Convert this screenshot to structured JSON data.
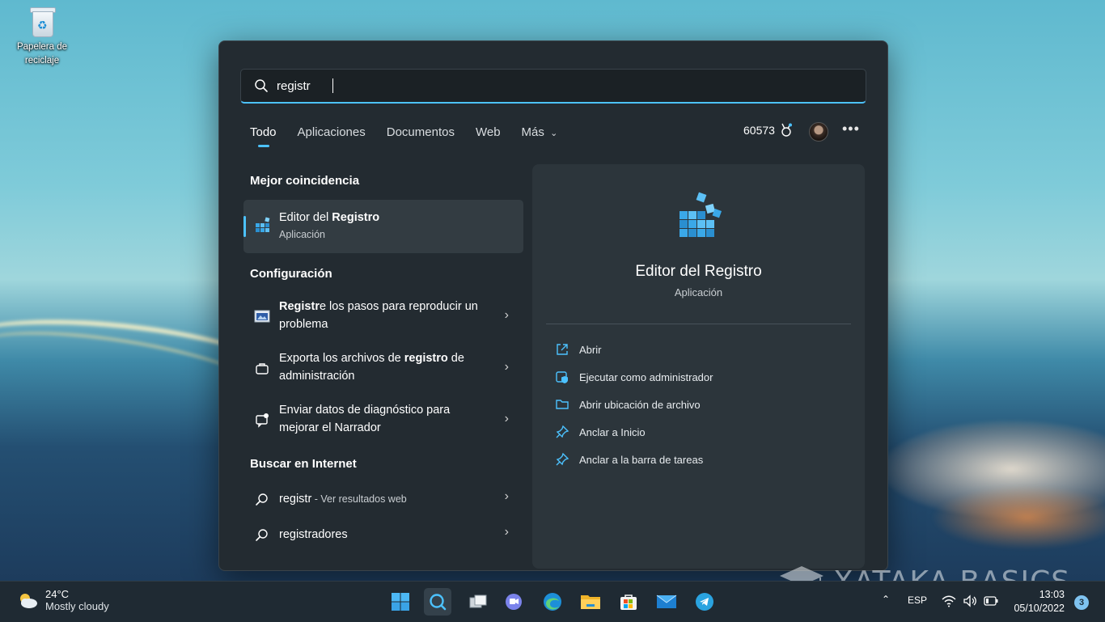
{
  "desktop": {
    "recycle_bin_label": "Papelera de reciclaje"
  },
  "search": {
    "query": "registr"
  },
  "tabs": [
    {
      "label": "Todo",
      "active": true
    },
    {
      "label": "Aplicaciones"
    },
    {
      "label": "Documentos"
    },
    {
      "label": "Web"
    },
    {
      "label": "Más"
    }
  ],
  "rewards": {
    "points": "60573"
  },
  "best_match": {
    "section_title": "Mejor coincidencia",
    "name_prefix": "Editor del ",
    "name_bold": "Registro",
    "type": "Aplicación"
  },
  "settings": {
    "section_title": "Configuración",
    "items": [
      {
        "bold": "Registr",
        "rest": "e los pasos para reproducir un problema"
      },
      {
        "pre": "Exporta los archivos de ",
        "bold": "registro",
        "rest": " de administración"
      },
      {
        "text": "Enviar datos de diagnóstico para mejorar el Narrador"
      }
    ]
  },
  "web": {
    "section_title": "Buscar en Internet",
    "items": [
      {
        "text": "registr",
        "suffix": " - Ver resultados web"
      },
      {
        "text": "registradores"
      }
    ]
  },
  "detail": {
    "title": "Editor del Registro",
    "subtitle": "Aplicación",
    "actions": [
      {
        "label": "Abrir",
        "icon": "open-external-icon"
      },
      {
        "label": "Ejecutar como administrador",
        "icon": "shield-admin-icon"
      },
      {
        "label": "Abrir ubicación de archivo",
        "icon": "folder-icon"
      },
      {
        "label": "Anclar a Inicio",
        "icon": "pin-icon"
      },
      {
        "label": "Anclar a la barra de tareas",
        "icon": "pin-icon"
      }
    ]
  },
  "taskbar": {
    "weather_temp": "24°C",
    "weather_condition": "Mostly cloudy",
    "language": "ESP",
    "time": "13:03",
    "date": "05/10/2022",
    "notification_count": "3"
  },
  "watermark": "XATAKA BASICS",
  "colors": {
    "accent": "#4cc2ff",
    "panel": "#232b31"
  }
}
